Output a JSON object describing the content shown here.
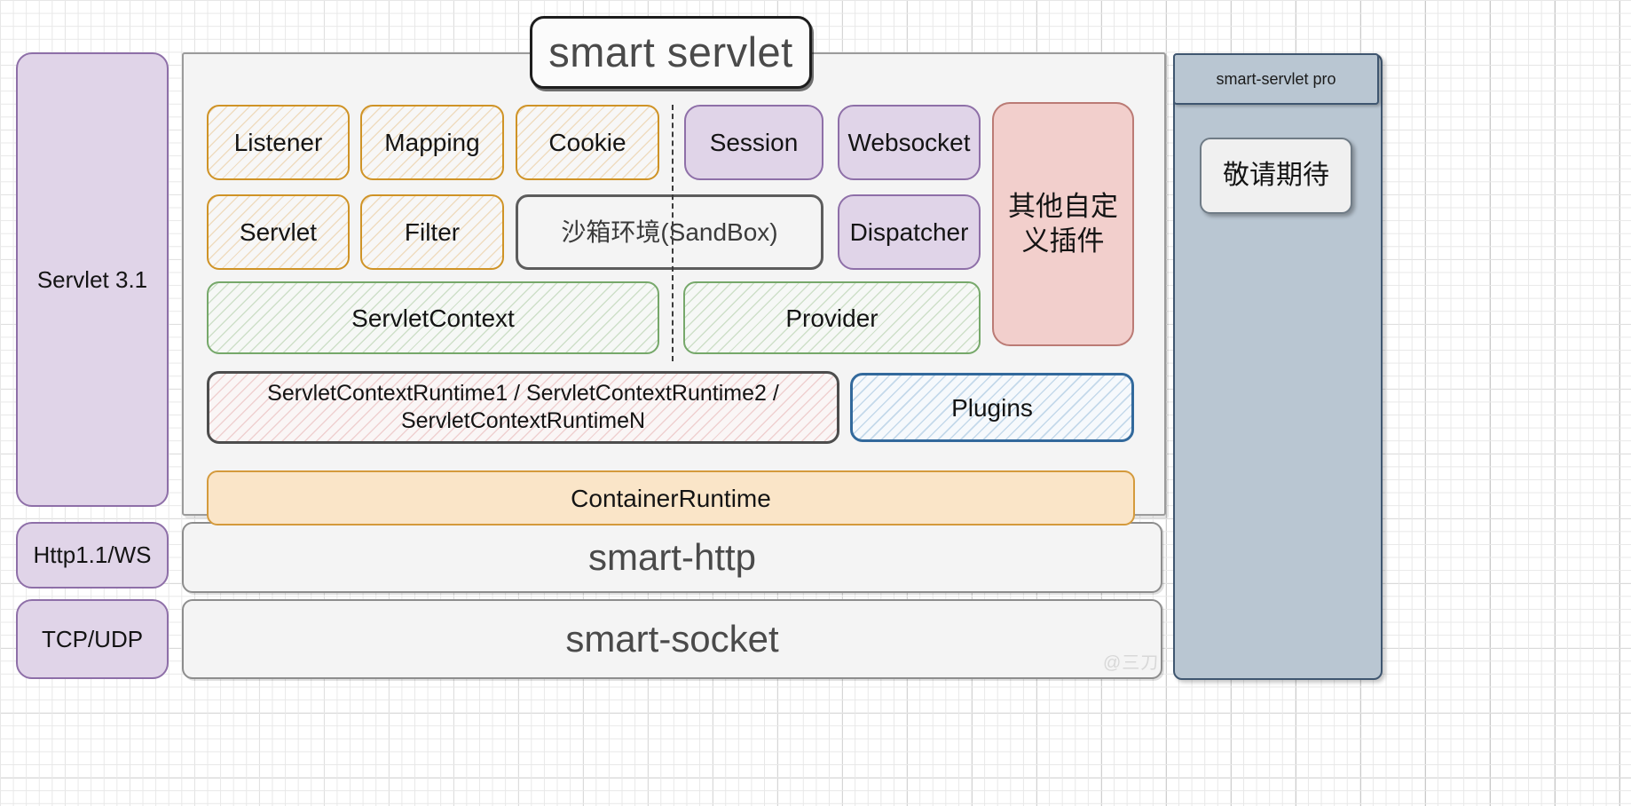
{
  "diagram": {
    "title": "smart servlet",
    "watermark": "@三刀"
  },
  "left_stack": [
    {
      "label": "Servlet 3.1"
    },
    {
      "label": "Http1.1/WS"
    },
    {
      "label": "TCP/UDP"
    }
  ],
  "core": {
    "row1": [
      {
        "label": "Listener",
        "style": "hatch-orange"
      },
      {
        "label": "Mapping",
        "style": "hatch-orange"
      },
      {
        "label": "Cookie",
        "style": "hatch-orange"
      },
      {
        "label": "Session",
        "style": "solid-purple"
      },
      {
        "label": "Websocket",
        "style": "solid-purple"
      }
    ],
    "row2": [
      {
        "label": "Servlet",
        "style": "hatch-orange"
      },
      {
        "label": "Filter",
        "style": "hatch-orange"
      },
      {
        "label": "沙箱环境(SandBox)",
        "style": "plain-gray"
      },
      {
        "label": "Dispatcher",
        "style": "solid-purple"
      }
    ],
    "row3": [
      {
        "label": "ServletContext",
        "style": "hatch-green"
      },
      {
        "label": "Provider",
        "style": "hatch-green"
      }
    ],
    "row4": [
      {
        "label": "ServletContextRuntime1 / ServletContextRuntime2 / ServletContextRuntimeN",
        "style": "hatch-pink"
      },
      {
        "label": "Plugins",
        "style": "hatch-blue"
      }
    ],
    "side_plugin": {
      "label": "其他自定义插件",
      "style": "solid-red"
    }
  },
  "bottom_stack": [
    {
      "label": "ContainerRuntime",
      "style": "solid-orange"
    },
    {
      "label": "smart-http",
      "style": "plain-light"
    },
    {
      "label": "smart-socket",
      "style": "plain-light"
    }
  ],
  "pro_panel": {
    "header": "smart-servlet pro",
    "inner": "敬请期待"
  },
  "colors": {
    "orange_border": "#cf9326",
    "green_border": "#76a86a",
    "pink_fill": "#f2cfcc",
    "purple_fill": "#e0d4e8",
    "blue_border": "#32699c",
    "pro_blue": "#b9c6d2"
  }
}
